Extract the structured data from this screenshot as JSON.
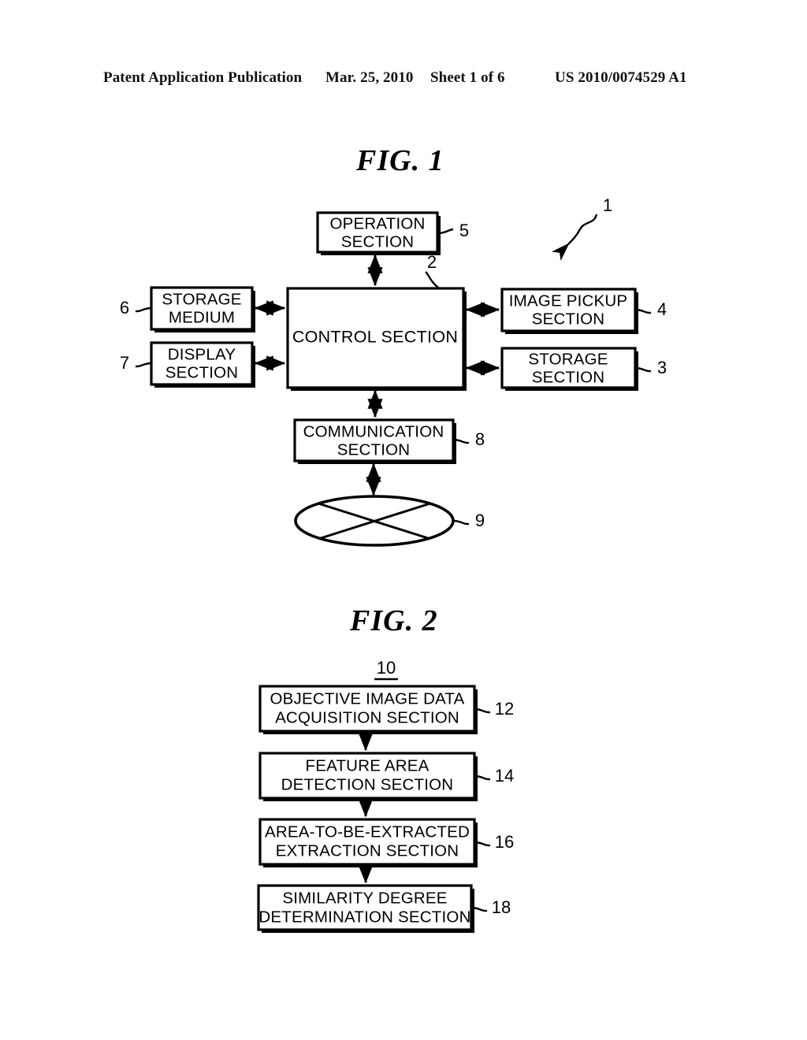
{
  "header": {
    "publication": "Patent Application Publication",
    "date": "Mar. 25, 2010",
    "sheet": "Sheet 1 of 6",
    "patent_number": "US 2010/0074529 A1"
  },
  "figures": [
    {
      "id": "fig1",
      "title": "FIG. 1",
      "system_ref": "1",
      "blocks": [
        {
          "ref": "5",
          "lines": [
            "OPERATION",
            "SECTION"
          ]
        },
        {
          "ref": "2",
          "lines": [
            "CONTROL SECTION"
          ]
        },
        {
          "ref": "6",
          "lines": [
            "STORAGE",
            "MEDIUM"
          ]
        },
        {
          "ref": "7",
          "lines": [
            "DISPLAY",
            "SECTION"
          ]
        },
        {
          "ref": "4",
          "lines": [
            "IMAGE PICKUP",
            "SECTION"
          ]
        },
        {
          "ref": "3",
          "lines": [
            "STORAGE",
            "SECTION"
          ]
        },
        {
          "ref": "8",
          "lines": [
            "COMMUNICATION",
            "SECTION"
          ]
        },
        {
          "ref": "9",
          "lines": [],
          "shape": "network-cloud"
        }
      ]
    },
    {
      "id": "fig2",
      "title": "FIG. 2",
      "system_ref": "10",
      "blocks": [
        {
          "ref": "12",
          "lines": [
            "OBJECTIVE IMAGE DATA",
            "ACQUISITION SECTION"
          ]
        },
        {
          "ref": "14",
          "lines": [
            "FEATURE AREA",
            "DETECTION SECTION"
          ]
        },
        {
          "ref": "16",
          "lines": [
            "AREA-TO-BE-EXTRACTED",
            "EXTRACTION SECTION"
          ]
        },
        {
          "ref": "18",
          "lines": [
            "SIMILARITY DEGREE",
            "DETERMINATION SECTION"
          ]
        }
      ]
    }
  ]
}
